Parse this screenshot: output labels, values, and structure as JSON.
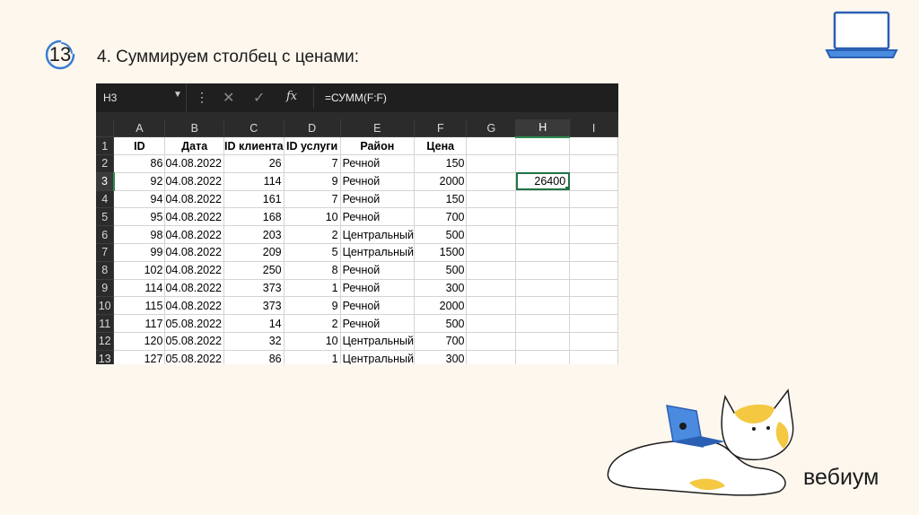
{
  "slide": {
    "number": "13",
    "title": "4. Суммируем столбец с ценами:",
    "brand": "вебиум",
    "accent_color": "#3a7bd5"
  },
  "excel": {
    "name_box": "H3",
    "formula": "=СУММ(F:F)",
    "icons": [
      "more-icon",
      "cancel-icon",
      "confirm-icon",
      "fx-icon"
    ],
    "columns": [
      "A",
      "B",
      "C",
      "D",
      "E",
      "F",
      "G",
      "H",
      "I"
    ],
    "selected_column": "H",
    "selected_row": "3",
    "header_row": [
      "ID",
      "Дата",
      "ID клиента",
      "ID услуги",
      "Район",
      "Цена"
    ],
    "rows": [
      [
        "86",
        "04.08.2022",
        "26",
        "7",
        "Речной",
        "150"
      ],
      [
        "92",
        "04.08.2022",
        "114",
        "9",
        "Речной",
        "2000"
      ],
      [
        "94",
        "04.08.2022",
        "161",
        "7",
        "Речной",
        "150"
      ],
      [
        "95",
        "04.08.2022",
        "168",
        "10",
        "Речной",
        "700"
      ],
      [
        "98",
        "04.08.2022",
        "203",
        "2",
        "Центральный",
        "500"
      ],
      [
        "99",
        "04.08.2022",
        "209",
        "5",
        "Центральный",
        "1500"
      ],
      [
        "102",
        "04.08.2022",
        "250",
        "8",
        "Речной",
        "500"
      ],
      [
        "114",
        "04.08.2022",
        "373",
        "1",
        "Речной",
        "300"
      ],
      [
        "115",
        "04.08.2022",
        "373",
        "9",
        "Речной",
        "2000"
      ],
      [
        "117",
        "05.08.2022",
        "14",
        "2",
        "Речной",
        "500"
      ],
      [
        "120",
        "05.08.2022",
        "32",
        "10",
        "Центральный",
        "700"
      ],
      [
        "127",
        "05.08.2022",
        "86",
        "1",
        "Центральный",
        "300"
      ]
    ],
    "row_numbers": [
      "1",
      "2",
      "3",
      "4",
      "5",
      "6",
      "7",
      "8",
      "9",
      "10",
      "11",
      "12",
      "13"
    ],
    "result_cell": {
      "ref": "H3",
      "value": "26400"
    }
  }
}
